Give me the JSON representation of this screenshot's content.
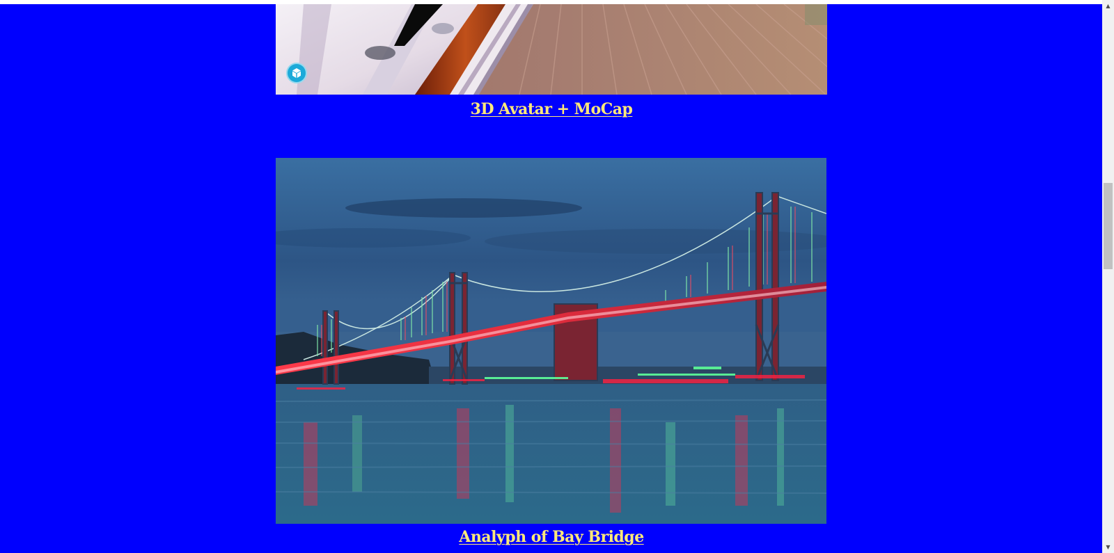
{
  "items": [
    {
      "caption": "3D Avatar + MoCap",
      "viewer_icon": "sketchfab-cube-icon"
    },
    {
      "caption": "Analyph of Bay Bridge"
    }
  ],
  "colors": {
    "background": "#0000fe",
    "caption": "#ffe97a",
    "badge": "#1caad9"
  }
}
